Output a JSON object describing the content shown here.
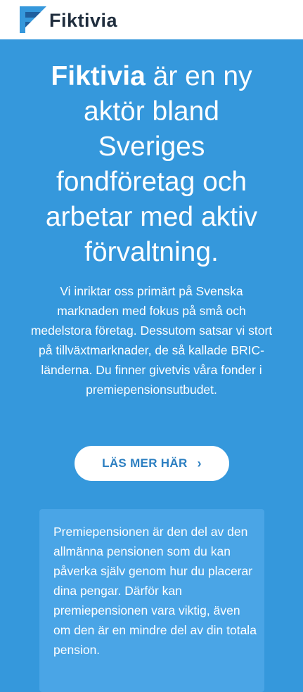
{
  "header": {
    "brand": "Fiktivia",
    "logo_icon": "fiktivia-logo-icon",
    "colors": {
      "logo_light": "#3598dc",
      "logo_dark": "#1f5f9e",
      "text": "#1f2d3d"
    }
  },
  "hero": {
    "headline_brand": "Fiktivia",
    "headline_rest": " är en ny aktör bland Sveriges fondföretag och arbetar med aktiv förvaltning.",
    "intro": "Vi inriktar oss primärt på Svenska marknaden med fokus på små och medelstora företag. Dessutom satsar vi stort på tillväxtmarknader, de så kallade BRIC-länderna. Du finner givetvis våra fonder i premiepensionsutbudet.",
    "cta_label": "LÄS MER HÄR",
    "cta_icon": "chevron-right-icon",
    "colors": {
      "background": "#3598dc",
      "cta_text": "#2c7fc1",
      "infobox": "#4aa5e6"
    }
  },
  "infobox": {
    "text": "Premiepensionen är den del av den allmänna pensionen som du kan påverka själv genom hur du placerar dina pengar. Därför kan premiepensionen vara viktig, även om den är en mindre del av din totala pension."
  }
}
